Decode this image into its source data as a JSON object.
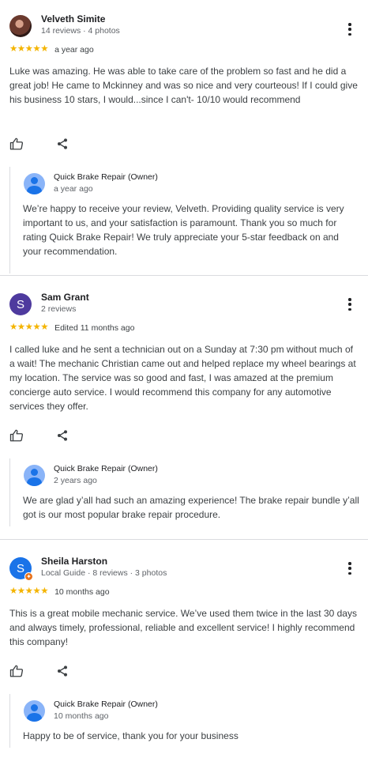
{
  "reviews": [
    {
      "name": "Velveth Simite",
      "avatar_initial": "",
      "meta": "14 reviews · 4 photos",
      "stars": "★★★★★",
      "time": "a year ago",
      "text": "Luke was amazing. He was able to take care of the problem so fast and he did a great job! He came to Mckinney and was so nice and very courteous! If I could give his business 10 stars, I would...since I can't- 10/10 would recommend",
      "reply": {
        "owner": "Quick Brake Repair (Owner)",
        "time": "a year ago",
        "text": "We’re happy to receive your review, Velveth. Providing quality service is very important to us, and your satisfaction is paramount. Thank you so much for rating Quick Brake Repair! We truly appreciate your 5-star feedback on and your recommendation."
      }
    },
    {
      "name": "Sam Grant",
      "avatar_initial": "S",
      "meta": "2 reviews",
      "stars": "★★★★★",
      "time": "Edited 11 months ago",
      "text": "I called luke and he sent a technician out on a Sunday at 7:30 pm without much of a wait! The mechanic Christian came out and helped replace my wheel bearings at my location. The service was so good and fast, I was amazed at the premium concierge auto service. I would recommend this company for any automotive services they offer.",
      "reply": {
        "owner": "Quick Brake Repair (Owner)",
        "time": "2 years ago",
        "text": "We are glad y’all had such an amazing experience! The brake repair bundle y’all got is our most popular brake repair procedure."
      }
    },
    {
      "name": "Sheila Harston",
      "avatar_initial": "S",
      "meta": "Local Guide · 8 reviews · 3 photos",
      "stars": "★★★★★",
      "time": "10 months ago",
      "text": "This is a great mobile mechanic service. We’ve used them twice in the last 30 days and always timely, professional, reliable and excellent service! I highly recommend this company!",
      "reply": {
        "owner": "Quick Brake Repair (Owner)",
        "time": "10 months ago",
        "text": "Happy to be of service, thank you for your business"
      }
    }
  ],
  "colors": {
    "star": "#f4b400",
    "avatar_purple": "#4e3a9e",
    "avatar_blue": "#1a73e8",
    "local_guide_badge": "#e8711a",
    "owner_avatar": "#8ab4f8",
    "divider": "#dadce0"
  },
  "icons": {
    "like": "thumbs-up-icon",
    "share": "share-icon",
    "menu": "more-vert-icon"
  }
}
